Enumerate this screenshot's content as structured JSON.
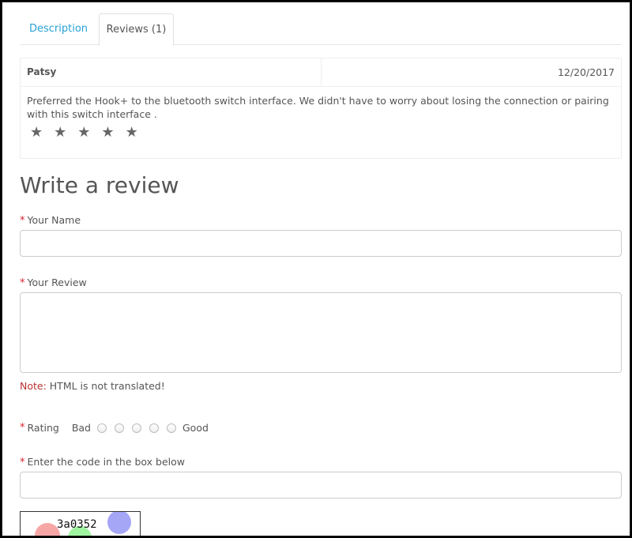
{
  "tabs": {
    "description": "Description",
    "reviews": "Reviews (1)"
  },
  "review": {
    "author": "Patsy",
    "date": "12/20/2017",
    "text": "Preferred the Hook+ to the bluetooth switch interface. We didn't have to worry about losing the connection or pairing with this switch interface .",
    "stars": 5
  },
  "form": {
    "title": "Write a review",
    "name_label": "Your Name",
    "review_label": "Your Review",
    "note_label": "Note:",
    "note_text": " HTML is not translated!",
    "rating_label": "Rating",
    "rating_bad": "Bad",
    "rating_good": "Good",
    "captcha_label": "Enter the code in the box below",
    "captcha_code": "3a0352",
    "required_mark": "*"
  },
  "colors": {
    "link": "#2aa2d6",
    "required": "#d9232d"
  }
}
